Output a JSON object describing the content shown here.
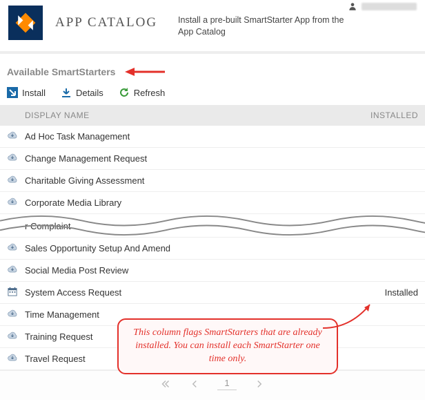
{
  "header": {
    "title": "APP CATALOG",
    "subtitle": "Install a pre-built SmartStarter App from the App Catalog"
  },
  "section": {
    "title": "Available SmartStarters"
  },
  "toolbar": {
    "install": "Install",
    "details": "Details",
    "refresh": "Refresh"
  },
  "columns": {
    "name": "DISPLAY NAME",
    "installed": "INSTALLED"
  },
  "rows": [
    {
      "name": "Ad Hoc Task Management",
      "installed": "",
      "icon": "cloud"
    },
    {
      "name": "Change Management Request",
      "installed": "",
      "icon": "cloud"
    },
    {
      "name": "Charitable Giving Assessment",
      "installed": "",
      "icon": "cloud"
    },
    {
      "name": "Corporate Media Library",
      "installed": "",
      "icon": "cloud"
    }
  ],
  "cut_fragment": "r Complaint",
  "rows2": [
    {
      "name": "Sales Opportunity Setup And Amend",
      "installed": "",
      "icon": "cloud"
    },
    {
      "name": "Social Media Post Review",
      "installed": "",
      "icon": "cloud"
    },
    {
      "name": "System Access Request",
      "installed": "Installed",
      "icon": "calendar"
    },
    {
      "name": "Time Management",
      "installed": "",
      "icon": "cloud"
    },
    {
      "name": "Training Request",
      "installed": "",
      "icon": "cloud"
    },
    {
      "name": "Travel Request",
      "installed": "",
      "icon": "cloud"
    }
  ],
  "callout": "This column flags SmartStarters that are already installed. You can install each SmartStarter one time only.",
  "pager": {
    "page": "1"
  }
}
